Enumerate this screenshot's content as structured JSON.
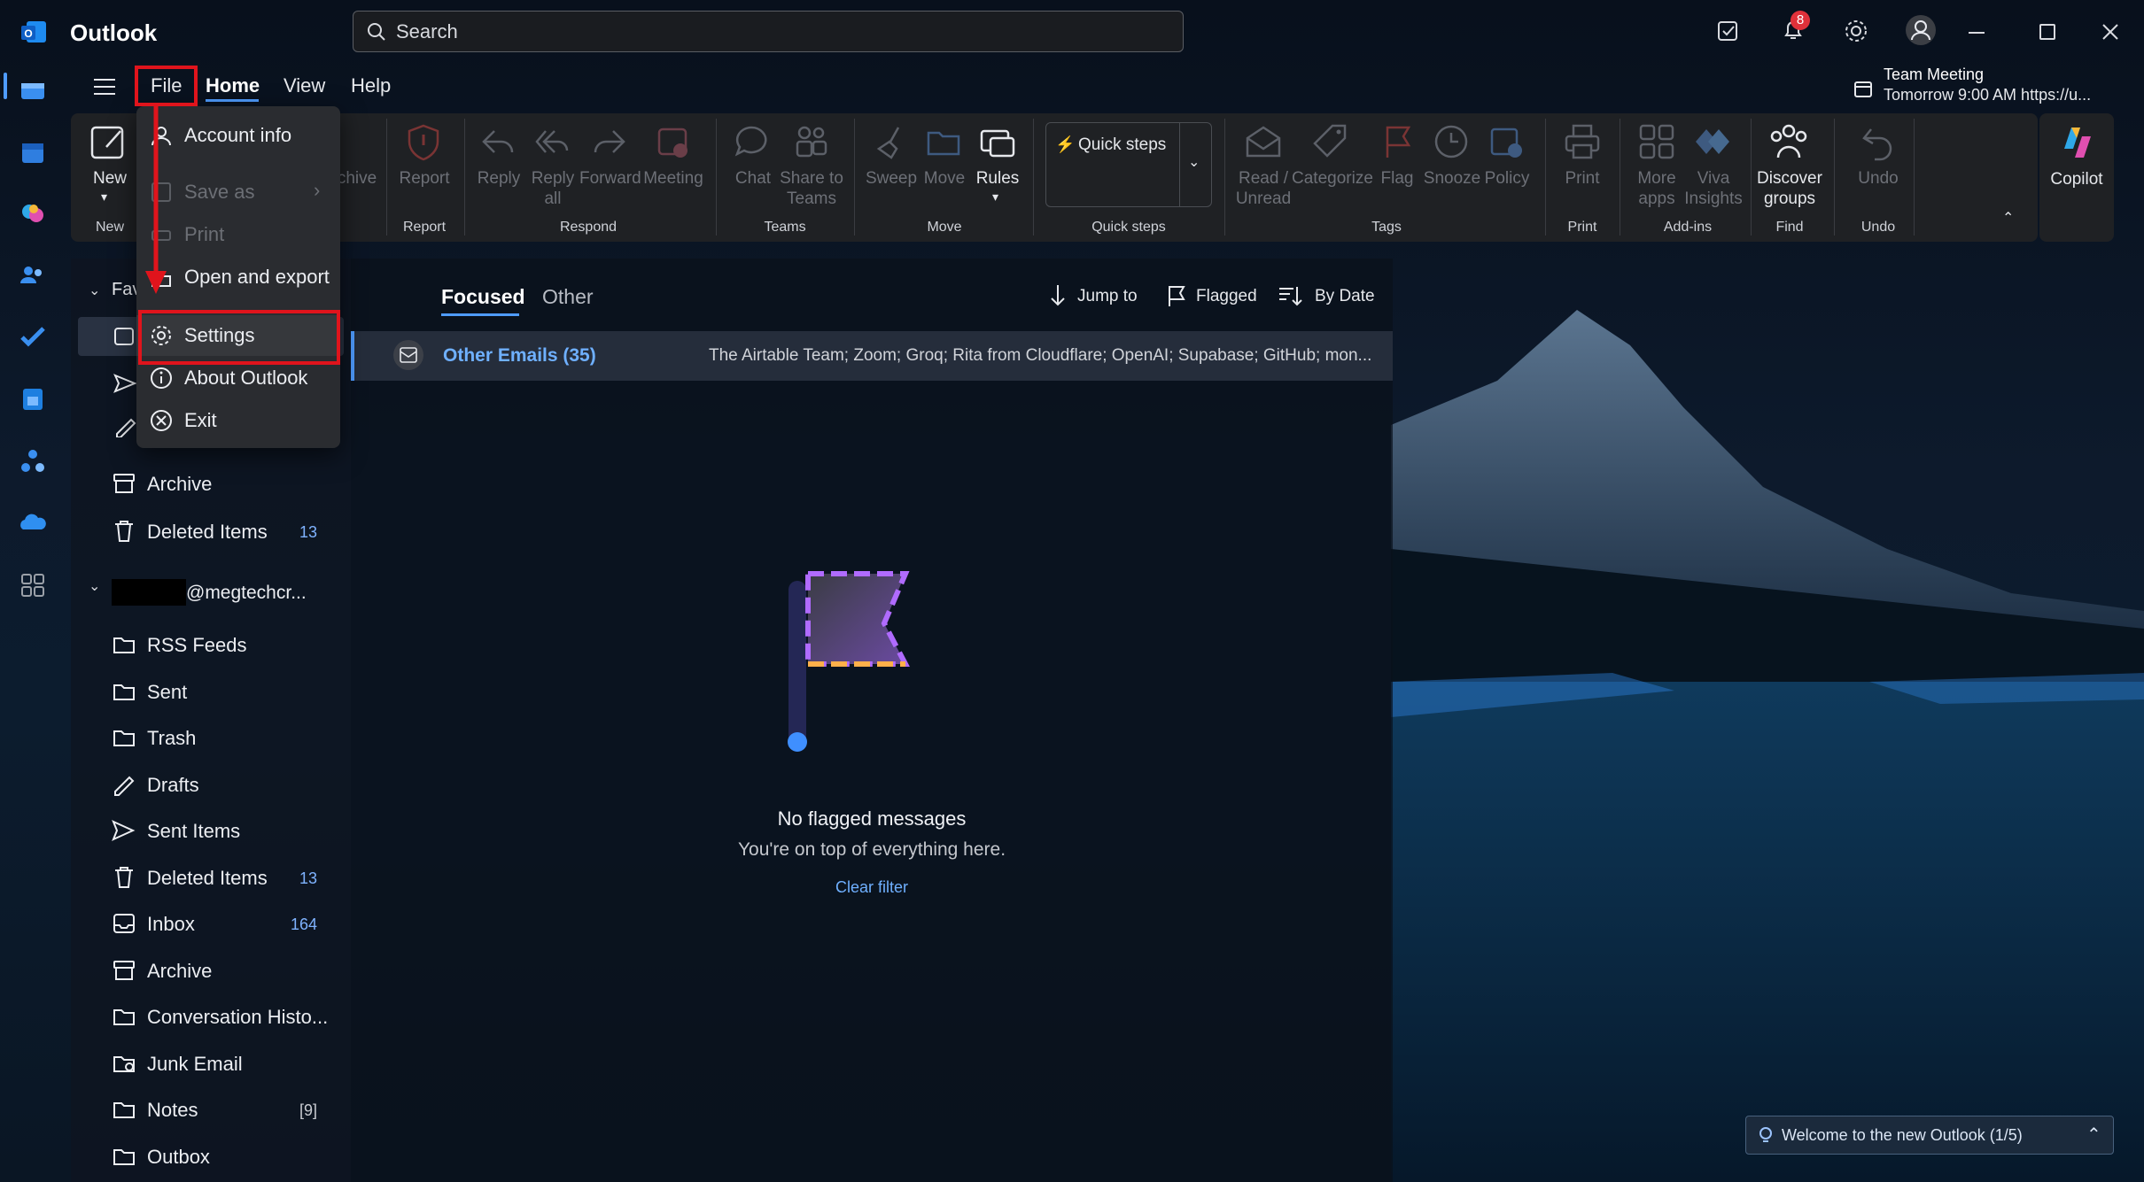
{
  "app": {
    "title": "Outlook"
  },
  "search": {
    "placeholder": "Search"
  },
  "notifications": {
    "badge": "8"
  },
  "menu_tabs": [
    "File",
    "Home",
    "View",
    "Help"
  ],
  "reminder": {
    "title": "Team Meeting",
    "detail": "Tomorrow 9:00 AM https://u..."
  },
  "file_menu": {
    "items": [
      {
        "label": "Account info",
        "enabled": true,
        "icon": "account-info-icon"
      },
      {
        "label": "Save as",
        "enabled": false,
        "icon": "save-as-icon"
      },
      {
        "label": "Print",
        "enabled": false,
        "icon": "print-icon"
      },
      {
        "label": "Open and export",
        "enabled": true,
        "icon": "open-export-icon"
      },
      {
        "label": "Settings",
        "enabled": true,
        "icon": "gear-icon"
      },
      {
        "label": "About Outlook",
        "enabled": true,
        "icon": "info-icon"
      },
      {
        "label": "Exit",
        "enabled": true,
        "icon": "exit-icon"
      }
    ]
  },
  "ribbon": {
    "new": {
      "label": "New",
      "group": "New"
    },
    "archive_partial": "chive",
    "report": {
      "label": "Report",
      "group": "Report"
    },
    "respond": {
      "reply": "Reply",
      "reply_all": "Reply all",
      "forward": "Forward",
      "meeting": "Meeting",
      "group": "Respond"
    },
    "teams": {
      "chat": "Chat",
      "share": "Share to Teams",
      "group": "Teams"
    },
    "move": {
      "sweep": "Sweep",
      "move": "Move",
      "rules": "Rules",
      "group": "Move"
    },
    "quick_steps": {
      "label": "Quick steps",
      "group": "Quick steps"
    },
    "tags": {
      "read_unread": "Read / Unread",
      "categorize": "Categorize",
      "flag": "Flag",
      "snooze": "Snooze",
      "policy": "Policy",
      "group": "Tags"
    },
    "print": {
      "label": "Print",
      "group": "Print"
    },
    "addins": {
      "more_apps": "More apps",
      "viva": "Viva Insights",
      "group": "Add-ins"
    },
    "find": {
      "discover": "Discover groups",
      "group": "Find"
    },
    "undo": {
      "label": "Undo",
      "group": "Undo"
    },
    "copilot": "Copilot"
  },
  "nav": {
    "favorites_partial": "Fav",
    "favorites": [
      {
        "label": "Archive",
        "icon": "archive-icon"
      },
      {
        "label": "Deleted Items",
        "count": "13",
        "icon": "trash-icon"
      }
    ],
    "account": "@megtechcr...",
    "folders": [
      {
        "label": "RSS Feeds",
        "count": "",
        "icon": "folder-icon"
      },
      {
        "label": "Sent",
        "count": "",
        "icon": "folder-icon"
      },
      {
        "label": "Trash",
        "count": "",
        "icon": "folder-icon"
      },
      {
        "label": "Drafts",
        "count": "",
        "icon": "drafts-icon"
      },
      {
        "label": "Sent Items",
        "count": "",
        "icon": "send-icon"
      },
      {
        "label": "Deleted Items",
        "count": "13",
        "icon": "trash-icon"
      },
      {
        "label": "Inbox",
        "count": "164",
        "icon": "inbox-icon"
      },
      {
        "label": "Archive",
        "count": "",
        "icon": "archive-icon"
      },
      {
        "label": "Conversation Histo...",
        "count": "",
        "icon": "folder-icon"
      },
      {
        "label": "Junk Email",
        "count": "",
        "icon": "junk-icon"
      },
      {
        "label": "Notes",
        "count": "[9]",
        "icon": "folder-icon"
      },
      {
        "label": "Outbox",
        "count": "",
        "icon": "outbox-icon"
      }
    ]
  },
  "message_list": {
    "tabs": [
      "Focused",
      "Other"
    ],
    "actions": {
      "jump_to": "Jump to",
      "flagged": "Flagged",
      "sort": "By Date"
    },
    "group_row": {
      "title": "Other Emails (35)",
      "preview": "The Airtable Team; Zoom; Groq; Rita from Cloudflare; OpenAI; Supabase; GitHub; mon..."
    },
    "empty": {
      "title": "No flagged messages",
      "subtitle": "You're on top of everything here.",
      "link": "Clear filter"
    }
  },
  "toast": {
    "text": "Welcome to the new Outlook (1/5)"
  },
  "colors": {
    "accent": "#4f9cff",
    "highlight": "#e0141c",
    "ribbon_bg": "#1f2124",
    "menu_bg": "#2a2c30"
  }
}
